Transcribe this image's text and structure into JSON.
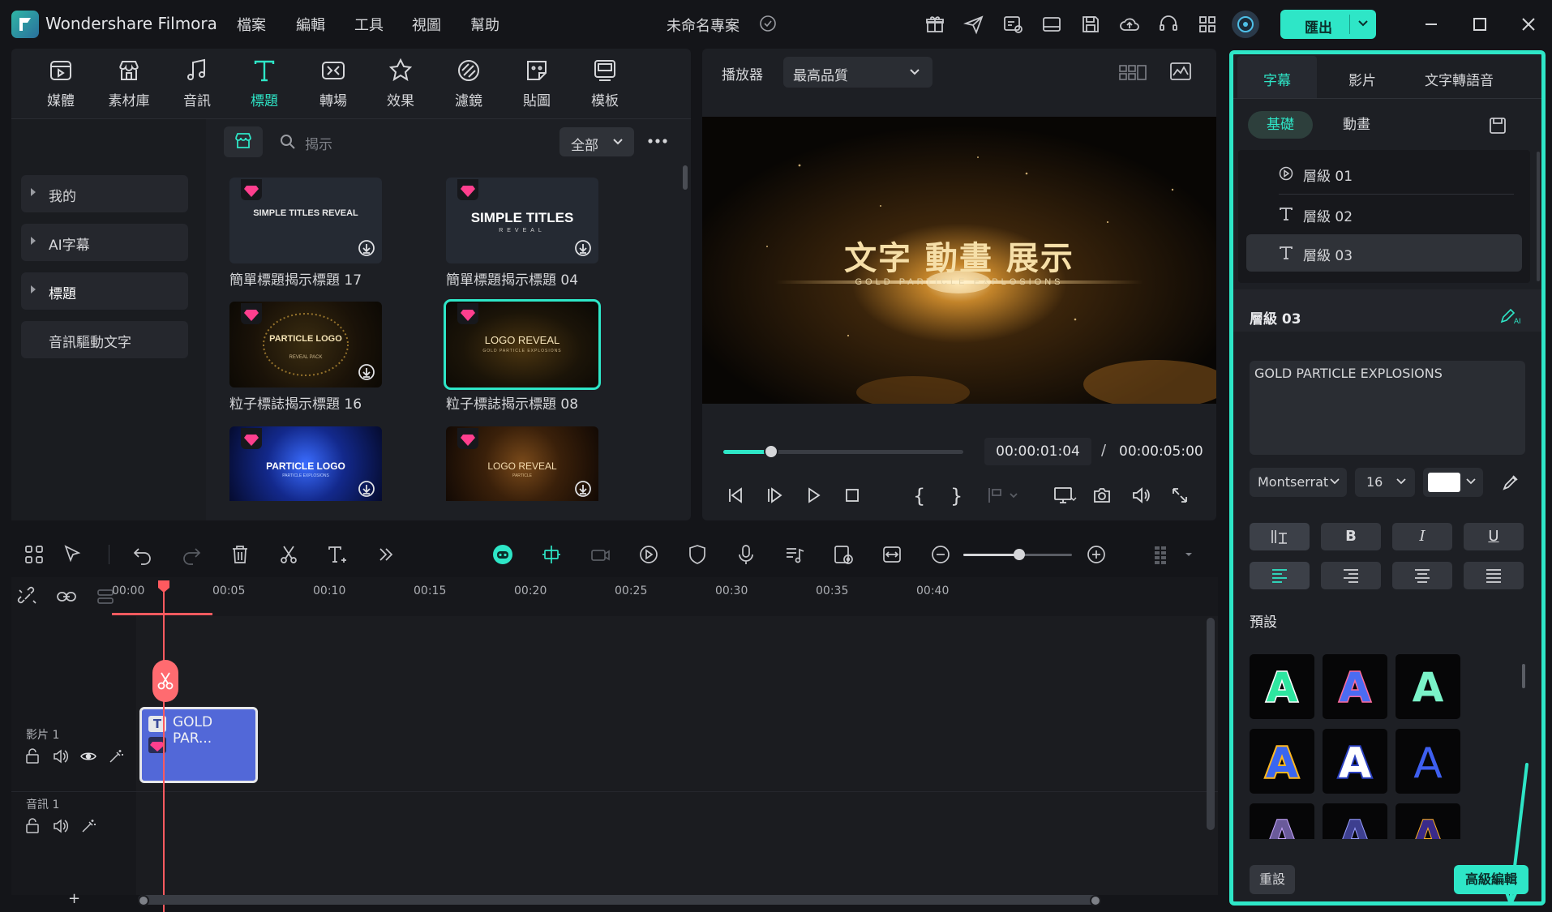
{
  "app": {
    "name": "Wondershare Filmora",
    "project_name": "未命名專案"
  },
  "menu": [
    "檔案",
    "編輯",
    "工具",
    "視圖",
    "幫助"
  ],
  "export_label": "匯出",
  "library": {
    "tabs": [
      "媒體",
      "素材庫",
      "音訊",
      "標題",
      "轉場",
      "效果",
      "濾鏡",
      "貼圖",
      "模板"
    ],
    "active_tab": "標題",
    "sidebar": [
      "我的",
      "AI字幕",
      "標題",
      "音訊驅動文字"
    ],
    "search_placeholder": "揭示",
    "filter_value": "全部",
    "items": [
      {
        "label": "簡單標題揭示標題 17",
        "thumb_text": "SIMPLE TITLES REVEAL"
      },
      {
        "label": "簡單標題揭示標題 04",
        "thumb_text": "SIMPLE TITLES",
        "thumb_sub": "REVEAL"
      },
      {
        "label": "粒子標誌揭示標題 16",
        "thumb_text": "PARTICLE LOGO",
        "thumb_sub": "REVEAL PACK"
      },
      {
        "label": "粒子標誌揭示標題 08",
        "thumb_text": "LOGO REVEAL",
        "thumb_sub": "GOLD PARTICLE EXPLOSIONS"
      },
      {
        "label": "",
        "thumb_text": "PARTICLE LOGO",
        "thumb_sub": "PARTICLE EXPLOSIONS"
      },
      {
        "label": "",
        "thumb_text": "LOGO REVEAL",
        "thumb_sub": "PARTICLE"
      }
    ]
  },
  "player": {
    "label": "播放器",
    "quality": "最高品質",
    "preview_title": "文字 動畫 展示",
    "preview_sub": "GOLD PARTICLE EXPLOSIONS",
    "current_time": "00:00:01:04",
    "separator": "/",
    "total_time": "00:00:05:00",
    "progress": 0.2
  },
  "props": {
    "tabs": [
      "字幕",
      "影片",
      "文字轉語音"
    ],
    "subtabs": [
      "基礎",
      "動畫"
    ],
    "layers": [
      "層級 01",
      "層級 02",
      "層級 03"
    ],
    "section_title": "層級 03",
    "text_value": "GOLD PARTICLE EXPLOSIONS",
    "font": "Montserrat",
    "font_size": "16",
    "text_color": "#ffffff",
    "preset_label": "預設",
    "reset_label": "重設",
    "advanced_label": "高級編輯"
  },
  "timeline": {
    "ruler": [
      "00:00",
      "00:05",
      "00:10",
      "00:15",
      "00:20",
      "00:25",
      "00:30",
      "00:35",
      "00:40"
    ],
    "tracks": [
      "影片 1",
      "音訊 1"
    ],
    "clip_title": "GOLD PAR...",
    "add_label": "+"
  },
  "colors": {
    "accent": "#2ee6c7",
    "playhead": "#ff5a5f",
    "clip": "#5268d8"
  }
}
